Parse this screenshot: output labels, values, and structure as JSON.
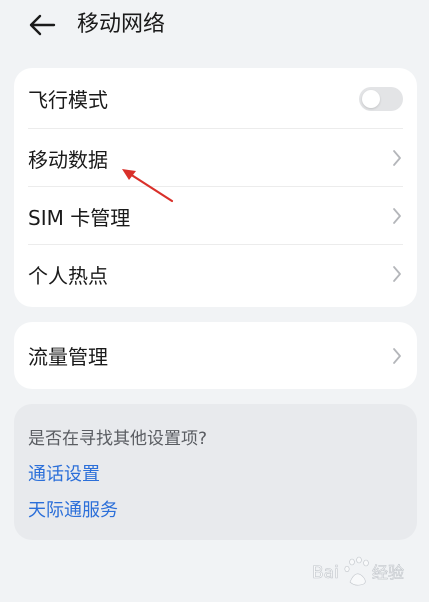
{
  "header": {
    "title": "移动网络",
    "back_icon": "arrow-left-icon"
  },
  "main_card": {
    "items": [
      {
        "label": "飞行模式",
        "control": "toggle",
        "on": false
      },
      {
        "label": "移动数据",
        "control": "chevron"
      },
      {
        "label": "SIM 卡管理",
        "control": "chevron"
      },
      {
        "label": "个人热点",
        "control": "chevron"
      }
    ]
  },
  "traffic_card": {
    "label": "流量管理"
  },
  "suggest_card": {
    "question": "是否在寻找其他设置项?",
    "links": [
      "通话设置",
      "天际通服务"
    ]
  },
  "colors": {
    "background": "#f1f3f5",
    "card": "#ffffff",
    "link": "#2b6fd9",
    "annotation_arrow": "#d9302a"
  }
}
